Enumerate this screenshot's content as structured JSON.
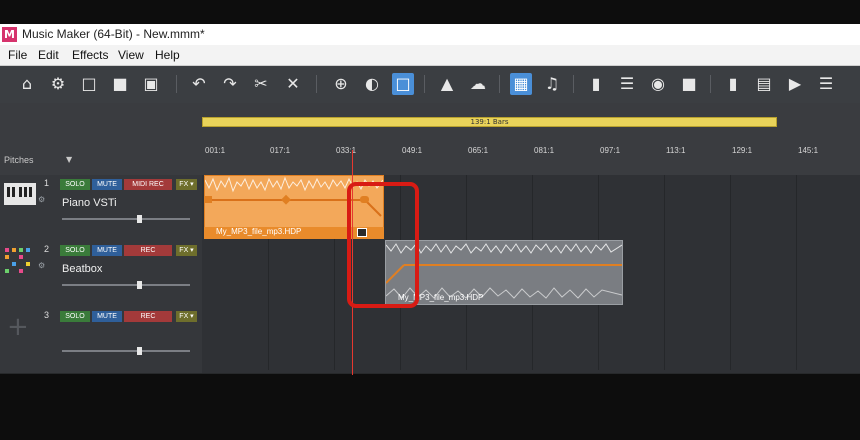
{
  "window": {
    "title": "Music Maker (64-Bit) - New.mmm*",
    "app_icon": "M"
  },
  "menu": [
    "File",
    "Edit",
    "Effects",
    "View",
    "Help"
  ],
  "toolbar_icons": [
    "home-icon",
    "gear-icon",
    "new-file-icon",
    "open-folder-icon",
    "save-icon",
    "undo-icon",
    "redo-icon",
    "cut-icon",
    "delete-icon",
    "add-icon",
    "mix-icon",
    "folder-icon",
    "shop-icon",
    "cloud-icon",
    "grid-icon",
    "note-icon",
    "keyboard-icon",
    "mixer-icon",
    "plugin-icon",
    "soundpool-icon",
    "levels-icon",
    "notes-icon",
    "video-icon",
    "extra-icon"
  ],
  "ruler": {
    "range_label": "139:1 Bars",
    "ticks": [
      "001:1",
      "017:1",
      "033:1",
      "049:1",
      "065:1",
      "081:1",
      "097:1",
      "113:1",
      "129:1",
      "145:1"
    ]
  },
  "side_label": "Pitches",
  "tracks": [
    {
      "number": "1",
      "name": "Piano VSTi",
      "solo": "SOLO",
      "mute": "MUTE",
      "rec": "MIDI REC",
      "fx": "FX ▾",
      "volume": 0.6
    },
    {
      "number": "2",
      "name": "Beatbox",
      "solo": "SOLO",
      "mute": "MUTE",
      "rec": "REC",
      "fx": "FX ▾",
      "volume": 0.6
    },
    {
      "number": "3",
      "name": "",
      "solo": "SOLO",
      "mute": "MUTE",
      "rec": "REC",
      "fx": "FX ▾",
      "volume": 0.6
    }
  ],
  "clips": [
    {
      "label": "My_MP3_file_mp3.HDP"
    },
    {
      "label": "My_MP3_file_mp3.HDP"
    }
  ],
  "colors": {
    "accent": "#4a8fd8",
    "playhead": "#e6382f",
    "clip_orange": "#f3a85a",
    "highlight": "#d81b14"
  }
}
